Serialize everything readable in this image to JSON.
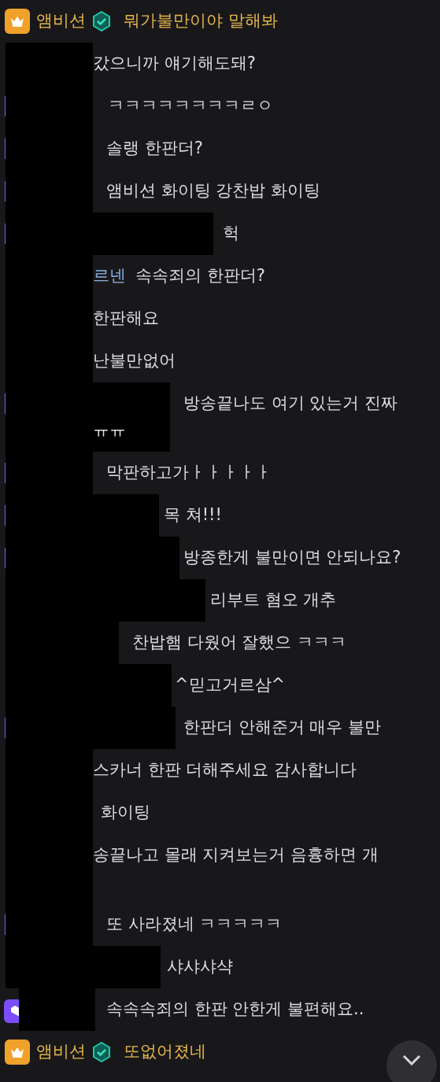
{
  "messages": [
    {
      "kind": "highlight",
      "user": "앰비션",
      "text": "뭐가불만이야 말해봐"
    },
    {
      "kind": "chat",
      "badge": false,
      "text": "갔으니까 얘기해도돼?"
    },
    {
      "kind": "chat",
      "badge": true,
      "text": "ㅋㅋㅋㅋㅋㅋㅋㅋㄹㅇ"
    },
    {
      "kind": "chat",
      "badge": true,
      "text": "솔랭 한판더?"
    },
    {
      "kind": "chat",
      "badge": true,
      "text": "앰비션 화이팅 강찬밥 화이팅"
    },
    {
      "kind": "chat",
      "badge": true,
      "text": "헉"
    },
    {
      "kind": "chat",
      "badge": false,
      "user": "르넨",
      "text": "속속죄의 한판더?"
    },
    {
      "kind": "chat",
      "badge": false,
      "text": "한판해요"
    },
    {
      "kind": "chat",
      "badge": false,
      "text": "난불만없어"
    },
    {
      "kind": "chat",
      "badge": true,
      "text": "방송끝나도 여기 있는거 진짜",
      "tail": "ㅠㅠ"
    },
    {
      "kind": "chat",
      "badge": true,
      "text": "막판하고가ㅏㅏㅏㅏㅏ"
    },
    {
      "kind": "chat",
      "badge": true,
      "text": "목 쳐!!!"
    },
    {
      "kind": "chat",
      "badge": true,
      "text": "방종한게 불만이면 안되나요?"
    },
    {
      "kind": "chat",
      "badge": false,
      "text": "리부트 혐오 개추"
    },
    {
      "kind": "chat",
      "badge": false,
      "text": "찬밥햄 다웠어 잘했으 ㅋㅋㅋ"
    },
    {
      "kind": "chat",
      "badge": false,
      "text": "^믿고거르삼^"
    },
    {
      "kind": "chat",
      "badge": true,
      "text": "한판더 안해준거 매우 불만"
    },
    {
      "kind": "chat",
      "badge": false,
      "text": "스카너 한판 더해주세요 감사합니다"
    },
    {
      "kind": "chat",
      "badge": false,
      "text": "화이팅"
    },
    {
      "kind": "chat",
      "badge": false,
      "text": "송끝나고 몰래 지켜보는거 음흉하면 개"
    },
    {
      "kind": "chat",
      "badge": true,
      "text": "또 사라졌네 ㅋㅋㅋㅋㅋ"
    },
    {
      "kind": "chat",
      "badge": false,
      "text": "샤샤샤샥"
    },
    {
      "kind": "subscriber",
      "badge": true,
      "text": "속속속죄의 한판 안한게 불편해요.."
    },
    {
      "kind": "highlight",
      "user": "앰비션",
      "text": "또없어졌네"
    }
  ]
}
